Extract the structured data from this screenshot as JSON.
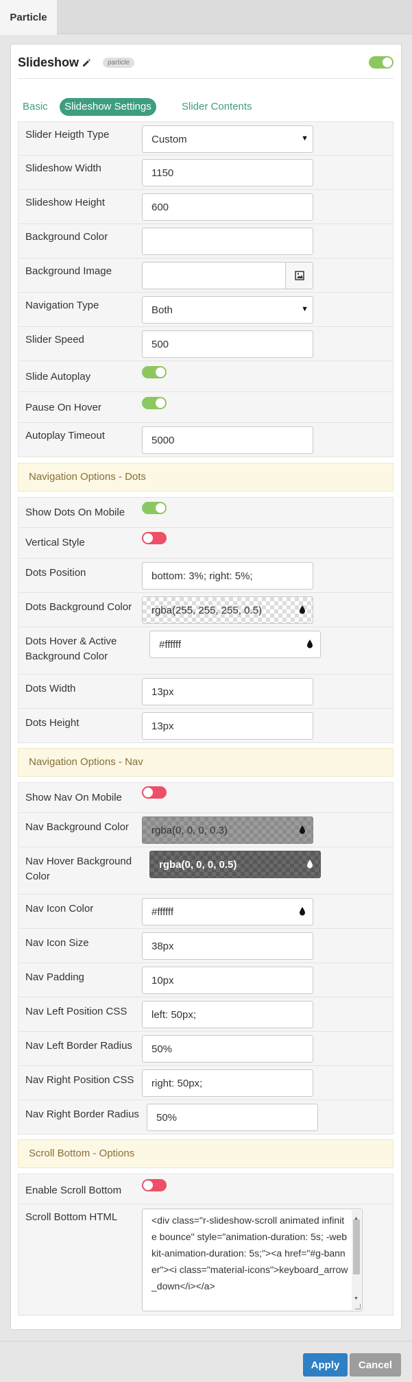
{
  "tab_bar": {
    "active_tab": "Particle"
  },
  "particle": {
    "title": "Slideshow",
    "badge": "particle",
    "enabled": true
  },
  "settings_tabs": [
    {
      "label": "Basic"
    },
    {
      "label": "Slideshow Settings"
    },
    {
      "label": "Slider Contents"
    }
  ],
  "fields": {
    "slider_height_type": {
      "label": "Slider Heigth Type",
      "value": "Custom"
    },
    "slideshow_width": {
      "label": "Slideshow Width",
      "value": "1150"
    },
    "slideshow_height": {
      "label": "Slideshow Height",
      "value": "600"
    },
    "background_color": {
      "label": "Background Color",
      "value": ""
    },
    "background_image": {
      "label": "Background Image",
      "value": ""
    },
    "navigation_type": {
      "label": "Navigation Type",
      "value": "Both"
    },
    "slider_speed": {
      "label": "Slider Speed",
      "value": "500"
    },
    "slide_autoplay": {
      "label": "Slide Autoplay",
      "on": true
    },
    "pause_on_hover": {
      "label": "Pause On Hover",
      "on": true
    },
    "autoplay_timeout": {
      "label": "Autoplay Timeout",
      "value": "5000"
    },
    "show_dots_mobile": {
      "label": "Show Dots On Mobile",
      "on": true
    },
    "vertical_style": {
      "label": "Vertical Style",
      "on": false
    },
    "dots_position": {
      "label": "Dots Position",
      "value": "bottom: 3%; right: 5%;"
    },
    "dots_bg_color": {
      "label": "Dots Background Color",
      "value": "rgba(255, 255, 255, 0.5)"
    },
    "dots_hover_bg": {
      "label_line1": "Dots Hover & Active",
      "label_line2": "Background Color",
      "value": "#ffffff"
    },
    "dots_width": {
      "label": "Dots Width",
      "value": "13px"
    },
    "dots_height": {
      "label": "Dots Height",
      "value": "13px"
    },
    "show_nav_mobile": {
      "label": "Show Nav On Mobile",
      "on": false
    },
    "nav_bg_color": {
      "label": "Nav Background Color",
      "value": "rgba(0, 0, 0, 0.3)"
    },
    "nav_hover_bg": {
      "label_line1": "Nav Hover Background",
      "label_line2": "Color",
      "value": "rgba(0, 0, 0, 0.5)"
    },
    "nav_icon_color": {
      "label": "Nav Icon Color",
      "value": "#ffffff"
    },
    "nav_icon_size": {
      "label": "Nav Icon Size",
      "value": "38px"
    },
    "nav_padding": {
      "label": "Nav Padding",
      "value": "10px"
    },
    "nav_left_pos": {
      "label": "Nav Left Position CSS",
      "value": "left: 50px;"
    },
    "nav_left_radius": {
      "label": "Nav Left Border Radius",
      "value": "50%"
    },
    "nav_right_pos": {
      "label": "Nav Right Position CSS",
      "value": "right: 50px;"
    },
    "nav_right_radius": {
      "label": "Nav Right Border Radius",
      "value": "50%"
    },
    "enable_scroll_bottom": {
      "label": "Enable Scroll Bottom",
      "on": false
    },
    "scroll_bottom_html": {
      "label": "Scroll Bottom HTML",
      "value": "<div class=\"r-slideshow-scroll animated infinite bounce\" style=\"animation-duration: 5s; -webkit-animation-duration: 5s;\"><a href=\"#g-banner\"><i class=\"material-icons\">keyboard_arrow_down</i></a>"
    }
  },
  "sections": {
    "dots": "Navigation Options - Dots",
    "nav": "Navigation Options - Nav",
    "scroll": "Scroll Bottom - Options"
  },
  "footer": {
    "apply": "Apply",
    "cancel": "Cancel"
  },
  "colors": {
    "accent": "#3e9d80",
    "toggle_on": "#8dc760",
    "toggle_off": "#ec4f67",
    "apply": "#2e7fc4",
    "cancel": "#9d9d9d"
  }
}
